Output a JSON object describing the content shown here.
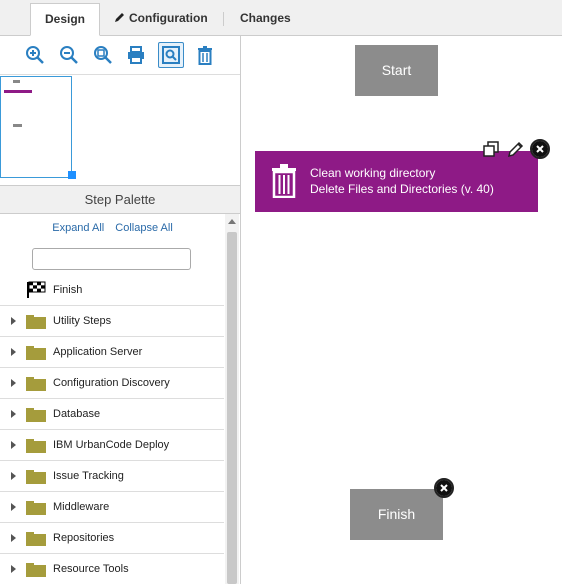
{
  "tabs": {
    "design": "Design",
    "configuration": "Configuration",
    "changes": "Changes"
  },
  "toolbar": {
    "zoom_in": "zoom-in-icon",
    "zoom_out": "zoom-out-icon",
    "zoom_fit": "zoom-fit-icon",
    "print": "print-icon",
    "overview": "overview-icon",
    "delete": "trash-icon"
  },
  "palette": {
    "title": "Step Palette",
    "expand_all": "Expand All",
    "collapse_all": "Collapse All",
    "search_placeholder": "",
    "items": [
      {
        "label": "Finish",
        "icon": "checkered-flag-icon"
      },
      {
        "label": "Utility Steps",
        "icon": "folder-icon"
      },
      {
        "label": "Application Server",
        "icon": "folder-icon"
      },
      {
        "label": "Configuration Discovery",
        "icon": "folder-icon"
      },
      {
        "label": "Database",
        "icon": "folder-icon"
      },
      {
        "label": "IBM UrbanCode Deploy",
        "icon": "folder-icon"
      },
      {
        "label": "Issue Tracking",
        "icon": "folder-icon"
      },
      {
        "label": "Middleware",
        "icon": "folder-icon"
      },
      {
        "label": "Repositories",
        "icon": "folder-icon"
      },
      {
        "label": "Resource Tools",
        "icon": "folder-icon"
      }
    ]
  },
  "canvas": {
    "start_label": "Start",
    "finish_label": "Finish",
    "step": {
      "name": "Clean working directory",
      "type": "Delete Files and Directories (v. 40)",
      "color": "#8e1a86"
    }
  },
  "colors": {
    "accent": "#3a8cc8",
    "step": "#8e1a86",
    "node": "#8c8c8c",
    "folder": "#a59c3c"
  }
}
